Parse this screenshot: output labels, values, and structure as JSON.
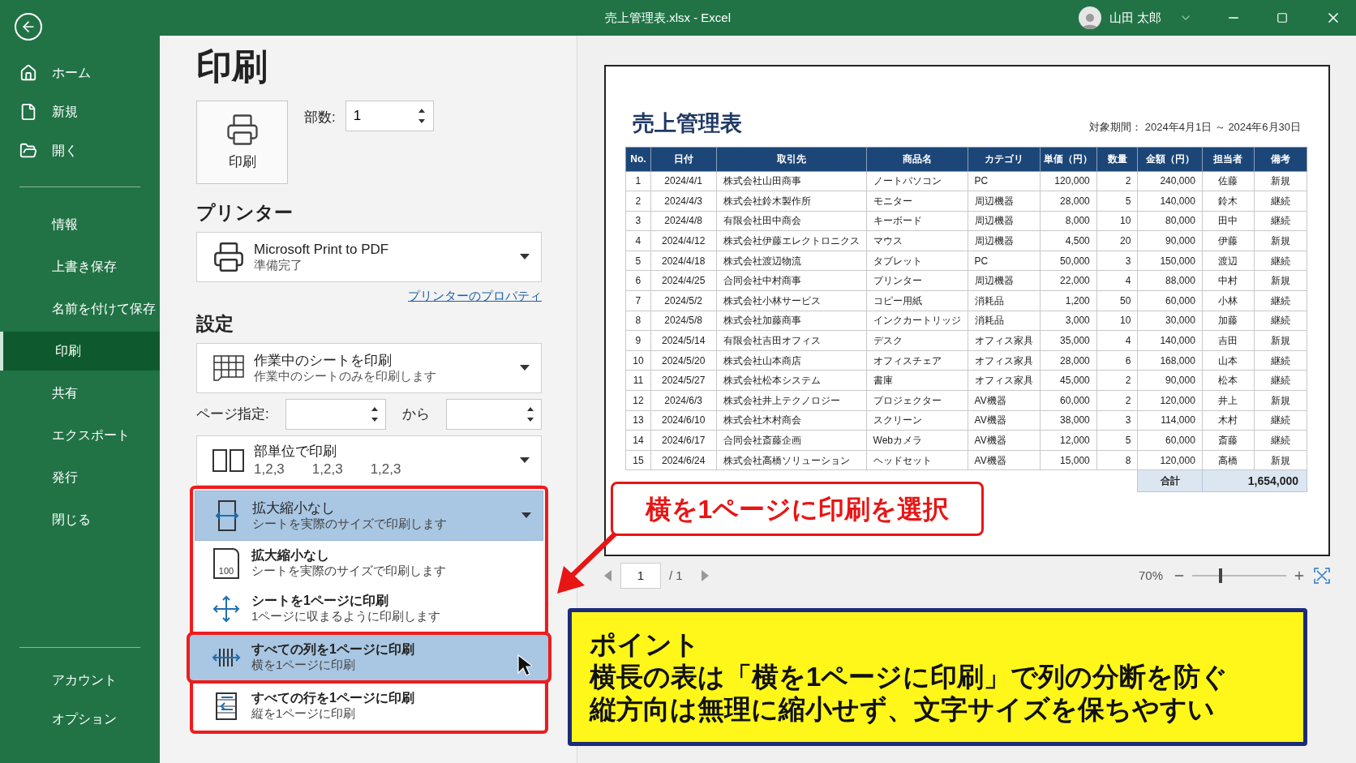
{
  "window": {
    "title": "売上管理表.xlsx  -  Excel",
    "user": "山田 太郎"
  },
  "sidebar": {
    "top_items": [
      {
        "label": "ホーム",
        "selected": false
      },
      {
        "label": "新規",
        "selected": false
      },
      {
        "label": "開く",
        "selected": false
      }
    ],
    "items": [
      {
        "label": "情報",
        "selected": false
      },
      {
        "label": "上書き保存",
        "selected": false
      },
      {
        "label": "名前を付けて保存",
        "selected": false
      },
      {
        "label": "印刷",
        "selected": true
      },
      {
        "label": "共有",
        "selected": false
      },
      {
        "label": "エクスポート",
        "selected": false
      },
      {
        "label": "発行",
        "selected": false
      },
      {
        "label": "閉じる",
        "selected": false
      }
    ],
    "bottom_items": [
      {
        "label": "アカウント",
        "selected": false
      },
      {
        "label": "オプション",
        "selected": false
      }
    ]
  },
  "print": {
    "heading": "印刷",
    "print_button": "印刷",
    "copies_label": "部数:",
    "copies_value": "1"
  },
  "printer": {
    "heading": "プリンター",
    "name": "Microsoft Print to PDF",
    "status": "準備完了",
    "properties_link": "プリンターのプロパティ"
  },
  "settings": {
    "heading": "設定",
    "print_what": {
      "title": "作業中のシートを印刷",
      "subtitle": "作業中のシートのみを印刷します"
    },
    "page_range": {
      "label": "ページ指定:",
      "to_label": "から"
    },
    "collate": {
      "title": "部単位で印刷",
      "sequences": [
        "1,2,3",
        "1,2,3",
        "1,2,3"
      ]
    },
    "scaling": {
      "title": "拡大縮小なし",
      "subtitle": "シートを実際のサイズで印刷します",
      "expanded": true
    },
    "scaling_options": [
      {
        "kind": "actual",
        "title": "拡大縮小なし",
        "subtitle": "シートを実際のサイズで印刷します",
        "selected": false,
        "icon_text": "100"
      },
      {
        "kind": "fit_sheet",
        "title": "シートを1ページに印刷",
        "subtitle": "1ページに収まるように印刷します",
        "selected": false
      },
      {
        "kind": "fit_columns",
        "title": "すべての列を1ページに印刷",
        "subtitle": "横を1ページに印刷",
        "selected": true
      },
      {
        "kind": "fit_rows",
        "title": "すべての行を1ページに印刷",
        "subtitle": "縦を1ページに印刷",
        "selected": false
      }
    ]
  },
  "preview": {
    "title": "売上管理表",
    "period": "対象期間：  2024年4月1日 ～ 2024年6月30日",
    "columns": [
      {
        "label": "No.",
        "kind": "center"
      },
      {
        "label": "日付",
        "kind": "center"
      },
      {
        "label": "取引先",
        "kind": "text"
      },
      {
        "label": "商品名",
        "kind": "text"
      },
      {
        "label": "カテゴリ",
        "kind": "text"
      },
      {
        "label": "単価（円）",
        "kind": "number"
      },
      {
        "label": "数量",
        "kind": "number"
      },
      {
        "label": "金額（円）",
        "kind": "number"
      },
      {
        "label": "担当者",
        "kind": "center"
      },
      {
        "label": "備考",
        "kind": "center"
      }
    ],
    "rows": [
      [
        "1",
        "2024/4/1",
        "株式会社山田商事",
        "ノートパソコン",
        "PC",
        "120,000",
        "2",
        "240,000",
        "佐藤",
        "新規"
      ],
      [
        "2",
        "2024/4/3",
        "株式会社鈴木製作所",
        "モニター",
        "周辺機器",
        "28,000",
        "5",
        "140,000",
        "鈴木",
        "継続"
      ],
      [
        "3",
        "2024/4/8",
        "有限会社田中商会",
        "キーボード",
        "周辺機器",
        "8,000",
        "10",
        "80,000",
        "田中",
        "継続"
      ],
      [
        "4",
        "2024/4/12",
        "株式会社伊藤エレクトロニクス",
        "マウス",
        "周辺機器",
        "4,500",
        "20",
        "90,000",
        "伊藤",
        "新規"
      ],
      [
        "5",
        "2024/4/18",
        "株式会社渡辺物流",
        "タブレット",
        "PC",
        "50,000",
        "3",
        "150,000",
        "渡辺",
        "継続"
      ],
      [
        "6",
        "2024/4/25",
        "合同会社中村商事",
        "プリンター",
        "周辺機器",
        "22,000",
        "4",
        "88,000",
        "中村",
        "新規"
      ],
      [
        "7",
        "2024/5/2",
        "株式会社小林サービス",
        "コピー用紙",
        "消耗品",
        "1,200",
        "50",
        "60,000",
        "小林",
        "継続"
      ],
      [
        "8",
        "2024/5/8",
        "株式会社加藤商事",
        "インクカートリッジ",
        "消耗品",
        "3,000",
        "10",
        "30,000",
        "加藤",
        "継続"
      ],
      [
        "9",
        "2024/5/14",
        "有限会社吉田オフィス",
        "デスク",
        "オフィス家具",
        "35,000",
        "4",
        "140,000",
        "吉田",
        "新規"
      ],
      [
        "10",
        "2024/5/20",
        "株式会社山本商店",
        "オフィスチェア",
        "オフィス家具",
        "28,000",
        "6",
        "168,000",
        "山本",
        "継続"
      ],
      [
        "11",
        "2024/5/27",
        "株式会社松本システム",
        "書庫",
        "オフィス家具",
        "45,000",
        "2",
        "90,000",
        "松本",
        "継続"
      ],
      [
        "12",
        "2024/6/3",
        "株式会社井上テクノロジー",
        "プロジェクター",
        "AV機器",
        "60,000",
        "2",
        "120,000",
        "井上",
        "新規"
      ],
      [
        "13",
        "2024/6/10",
        "株式会社木村商会",
        "スクリーン",
        "AV機器",
        "38,000",
        "3",
        "114,000",
        "木村",
        "継続"
      ],
      [
        "14",
        "2024/6/17",
        "合同会社斎藤企画",
        "Webカメラ",
        "AV機器",
        "12,000",
        "5",
        "60,000",
        "斎藤",
        "継続"
      ],
      [
        "15",
        "2024/6/24",
        "株式会社高橋ソリューション",
        "ヘッドセット",
        "AV機器",
        "15,000",
        "8",
        "120,000",
        "高橋",
        "新規"
      ]
    ],
    "total_label": "合計",
    "total_value": "1,654,000"
  },
  "pager": {
    "page": "1",
    "of": "/ 1",
    "zoom": "70%",
    "zoom_level": {
      "level": 0.3
    }
  },
  "annotations": {
    "callout": "横を1ページに印刷を選択",
    "point": {
      "title": "ポイント",
      "lines": [
        "横長の表は「横を1ページに印刷」で列の分断を防ぐ",
        "縦方向は無理に縮小せず、文字サイズを保ちやすい"
      ]
    }
  }
}
